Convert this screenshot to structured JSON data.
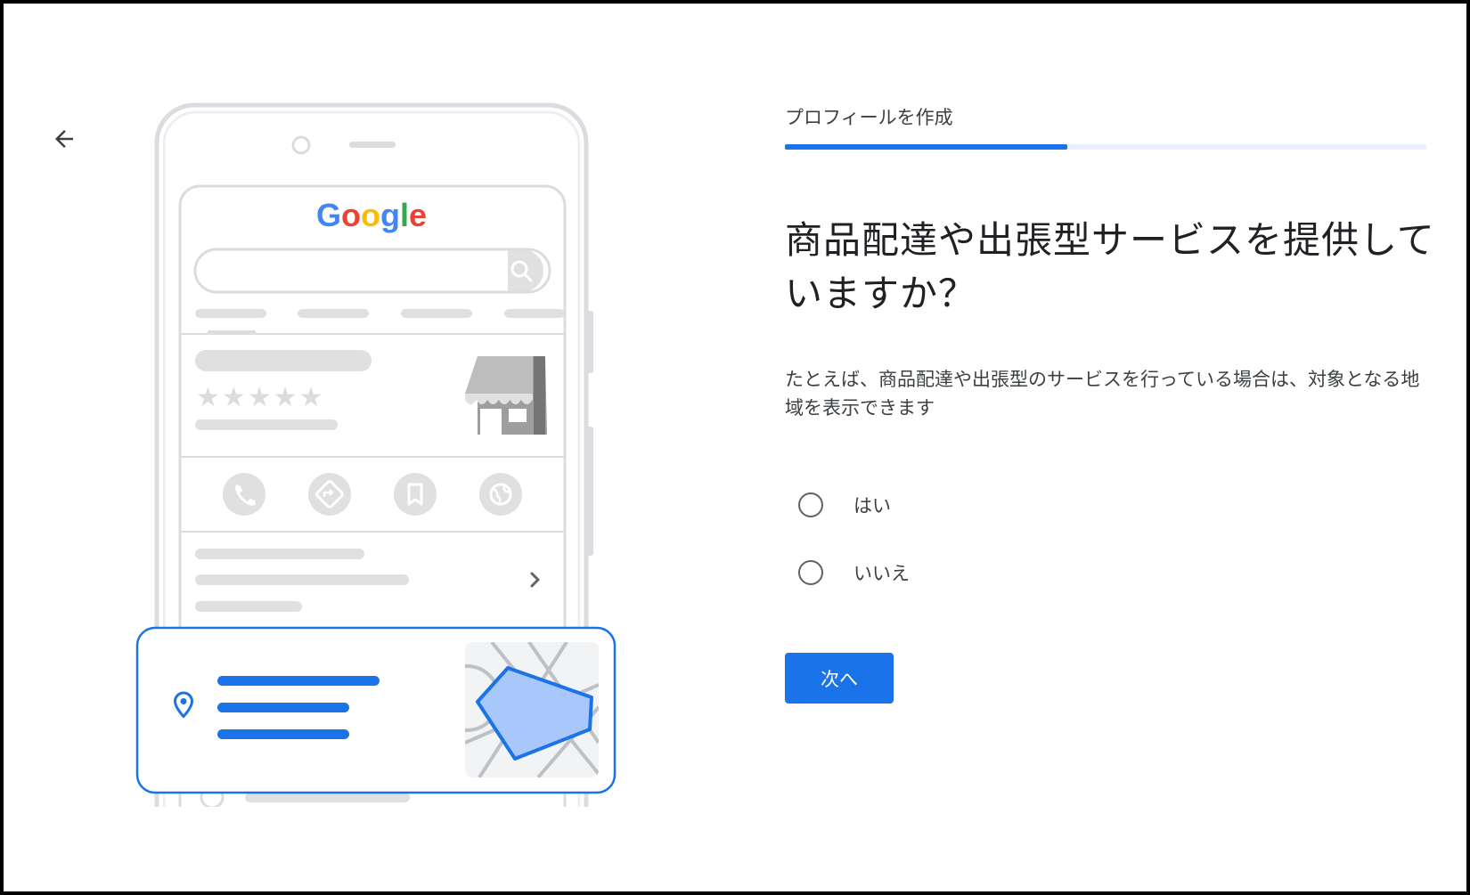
{
  "illustration": {
    "brand_text": "Google",
    "brand_colors": [
      "#4285F4",
      "#EA4335",
      "#FBBC05",
      "#4285F4",
      "#34A853",
      "#EA4335"
    ],
    "rating_stars": "★★★★★"
  },
  "header": {
    "progress_label": "プロフィールを作成",
    "progress_fraction": 0.44
  },
  "main": {
    "question": "商品配達や出張型サービスを提供していますか？",
    "description": "たとえば、商品配達や出張型のサービスを行っている場合は、対象となる地域を表示できます",
    "options": [
      {
        "label": "はい",
        "selected": false
      },
      {
        "label": "いいえ",
        "selected": false
      }
    ],
    "next_label": "次へ"
  },
  "colors": {
    "accent": "#1a73e8",
    "track": "#e8f0fe",
    "map_area": "#a8c7fa"
  }
}
